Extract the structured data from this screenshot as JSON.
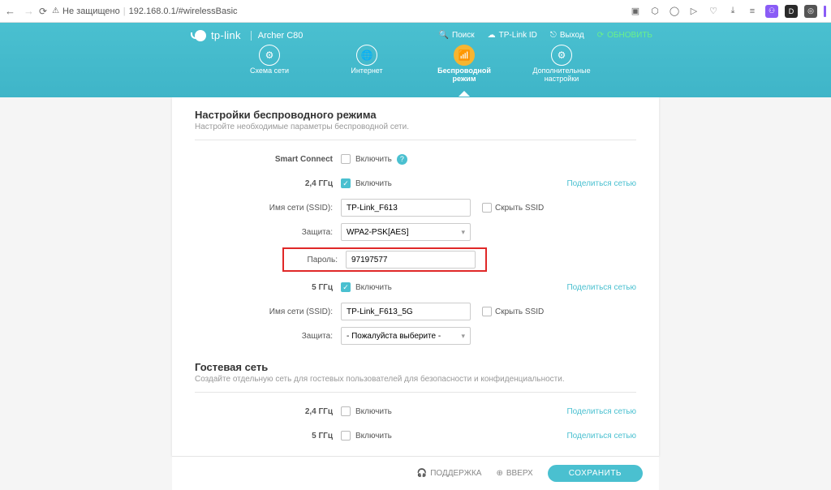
{
  "browser": {
    "secure_label": "Не защищено",
    "url": "192.168.0.1/#wirelessBasic"
  },
  "header": {
    "brand": "tp-link",
    "model": "Archer C80",
    "links": {
      "search": "Поиск",
      "tplink_id": "TP-Link ID",
      "logout": "Выход",
      "refresh": "ОБНОВИТЬ"
    },
    "tabs": {
      "map": "Схема сети",
      "internet": "Интернет",
      "wireless": "Беспроводной режим",
      "advanced": "Дополнительные настройки"
    }
  },
  "wireless": {
    "title": "Настройки беспроводного режима",
    "desc": "Настройте необходимые параметры беспроводной сети.",
    "rows": {
      "smart_connect": {
        "label": "Smart Connect",
        "enable": "Включить"
      },
      "ghz24": {
        "label": "2,4 ГГц",
        "enable": "Включить",
        "share": "Поделиться сетью"
      },
      "ssid": {
        "label": "Имя сети (SSID):",
        "value": "TP-Link_F613",
        "hide": "Скрыть SSID"
      },
      "security": {
        "label": "Защита:",
        "value": "WPA2-PSK[AES]"
      },
      "password": {
        "label": "Пароль:",
        "value": "97197577"
      },
      "ghz5": {
        "label": "5 ГГц",
        "enable": "Включить",
        "share": "Поделиться сетью"
      },
      "ssid5": {
        "label": "Имя сети (SSID):",
        "value": "TP-Link_F613_5G",
        "hide": "Скрыть SSID"
      },
      "security5": {
        "label": "Защита:",
        "value": "- Пожалуйста выберите -"
      }
    }
  },
  "guest": {
    "title": "Гостевая сеть",
    "desc": "Создайте отдельную сеть для гостевых пользователей для безопасности и конфиденциальности.",
    "ghz24": {
      "label": "2,4 ГГц",
      "enable": "Включить",
      "share": "Поделиться сетью"
    },
    "ghz5": {
      "label": "5 ГГц",
      "enable": "Включить",
      "share": "Поделиться сетью"
    }
  },
  "footer": {
    "support": "ПОДДЕРЖКА",
    "top": "ВВЕРХ",
    "save": "СОХРАНИТЬ"
  }
}
